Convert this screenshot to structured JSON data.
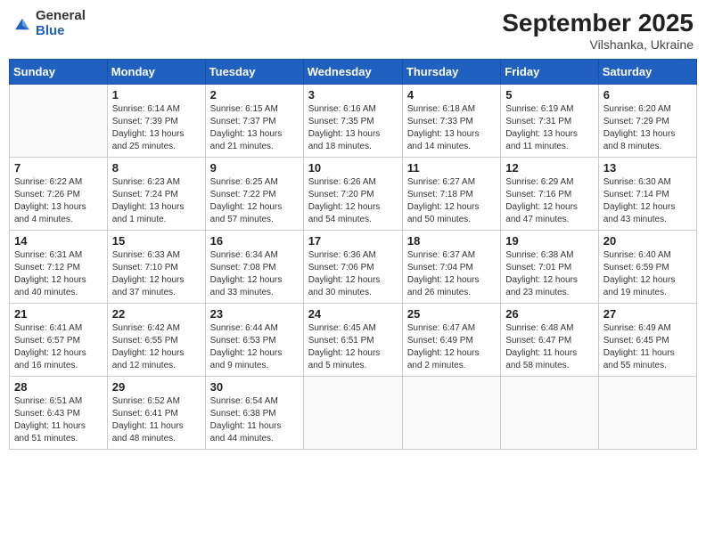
{
  "header": {
    "logo": {
      "general": "General",
      "blue": "Blue"
    },
    "title": "September 2025",
    "location": "Vilshanka, Ukraine"
  },
  "days_of_week": [
    "Sunday",
    "Monday",
    "Tuesday",
    "Wednesday",
    "Thursday",
    "Friday",
    "Saturday"
  ],
  "weeks": [
    [
      {
        "day": "",
        "info": ""
      },
      {
        "day": "1",
        "info": "Sunrise: 6:14 AM\nSunset: 7:39 PM\nDaylight: 13 hours\nand 25 minutes."
      },
      {
        "day": "2",
        "info": "Sunrise: 6:15 AM\nSunset: 7:37 PM\nDaylight: 13 hours\nand 21 minutes."
      },
      {
        "day": "3",
        "info": "Sunrise: 6:16 AM\nSunset: 7:35 PM\nDaylight: 13 hours\nand 18 minutes."
      },
      {
        "day": "4",
        "info": "Sunrise: 6:18 AM\nSunset: 7:33 PM\nDaylight: 13 hours\nand 14 minutes."
      },
      {
        "day": "5",
        "info": "Sunrise: 6:19 AM\nSunset: 7:31 PM\nDaylight: 13 hours\nand 11 minutes."
      },
      {
        "day": "6",
        "info": "Sunrise: 6:20 AM\nSunset: 7:29 PM\nDaylight: 13 hours\nand 8 minutes."
      }
    ],
    [
      {
        "day": "7",
        "info": "Sunrise: 6:22 AM\nSunset: 7:26 PM\nDaylight: 13 hours\nand 4 minutes."
      },
      {
        "day": "8",
        "info": "Sunrise: 6:23 AM\nSunset: 7:24 PM\nDaylight: 13 hours\nand 1 minute."
      },
      {
        "day": "9",
        "info": "Sunrise: 6:25 AM\nSunset: 7:22 PM\nDaylight: 12 hours\nand 57 minutes."
      },
      {
        "day": "10",
        "info": "Sunrise: 6:26 AM\nSunset: 7:20 PM\nDaylight: 12 hours\nand 54 minutes."
      },
      {
        "day": "11",
        "info": "Sunrise: 6:27 AM\nSunset: 7:18 PM\nDaylight: 12 hours\nand 50 minutes."
      },
      {
        "day": "12",
        "info": "Sunrise: 6:29 AM\nSunset: 7:16 PM\nDaylight: 12 hours\nand 47 minutes."
      },
      {
        "day": "13",
        "info": "Sunrise: 6:30 AM\nSunset: 7:14 PM\nDaylight: 12 hours\nand 43 minutes."
      }
    ],
    [
      {
        "day": "14",
        "info": "Sunrise: 6:31 AM\nSunset: 7:12 PM\nDaylight: 12 hours\nand 40 minutes."
      },
      {
        "day": "15",
        "info": "Sunrise: 6:33 AM\nSunset: 7:10 PM\nDaylight: 12 hours\nand 37 minutes."
      },
      {
        "day": "16",
        "info": "Sunrise: 6:34 AM\nSunset: 7:08 PM\nDaylight: 12 hours\nand 33 minutes."
      },
      {
        "day": "17",
        "info": "Sunrise: 6:36 AM\nSunset: 7:06 PM\nDaylight: 12 hours\nand 30 minutes."
      },
      {
        "day": "18",
        "info": "Sunrise: 6:37 AM\nSunset: 7:04 PM\nDaylight: 12 hours\nand 26 minutes."
      },
      {
        "day": "19",
        "info": "Sunrise: 6:38 AM\nSunset: 7:01 PM\nDaylight: 12 hours\nand 23 minutes."
      },
      {
        "day": "20",
        "info": "Sunrise: 6:40 AM\nSunset: 6:59 PM\nDaylight: 12 hours\nand 19 minutes."
      }
    ],
    [
      {
        "day": "21",
        "info": "Sunrise: 6:41 AM\nSunset: 6:57 PM\nDaylight: 12 hours\nand 16 minutes."
      },
      {
        "day": "22",
        "info": "Sunrise: 6:42 AM\nSunset: 6:55 PM\nDaylight: 12 hours\nand 12 minutes."
      },
      {
        "day": "23",
        "info": "Sunrise: 6:44 AM\nSunset: 6:53 PM\nDaylight: 12 hours\nand 9 minutes."
      },
      {
        "day": "24",
        "info": "Sunrise: 6:45 AM\nSunset: 6:51 PM\nDaylight: 12 hours\nand 5 minutes."
      },
      {
        "day": "25",
        "info": "Sunrise: 6:47 AM\nSunset: 6:49 PM\nDaylight: 12 hours\nand 2 minutes."
      },
      {
        "day": "26",
        "info": "Sunrise: 6:48 AM\nSunset: 6:47 PM\nDaylight: 11 hours\nand 58 minutes."
      },
      {
        "day": "27",
        "info": "Sunrise: 6:49 AM\nSunset: 6:45 PM\nDaylight: 11 hours\nand 55 minutes."
      }
    ],
    [
      {
        "day": "28",
        "info": "Sunrise: 6:51 AM\nSunset: 6:43 PM\nDaylight: 11 hours\nand 51 minutes."
      },
      {
        "day": "29",
        "info": "Sunrise: 6:52 AM\nSunset: 6:41 PM\nDaylight: 11 hours\nand 48 minutes."
      },
      {
        "day": "30",
        "info": "Sunrise: 6:54 AM\nSunset: 6:38 PM\nDaylight: 11 hours\nand 44 minutes."
      },
      {
        "day": "",
        "info": ""
      },
      {
        "day": "",
        "info": ""
      },
      {
        "day": "",
        "info": ""
      },
      {
        "day": "",
        "info": ""
      }
    ]
  ]
}
